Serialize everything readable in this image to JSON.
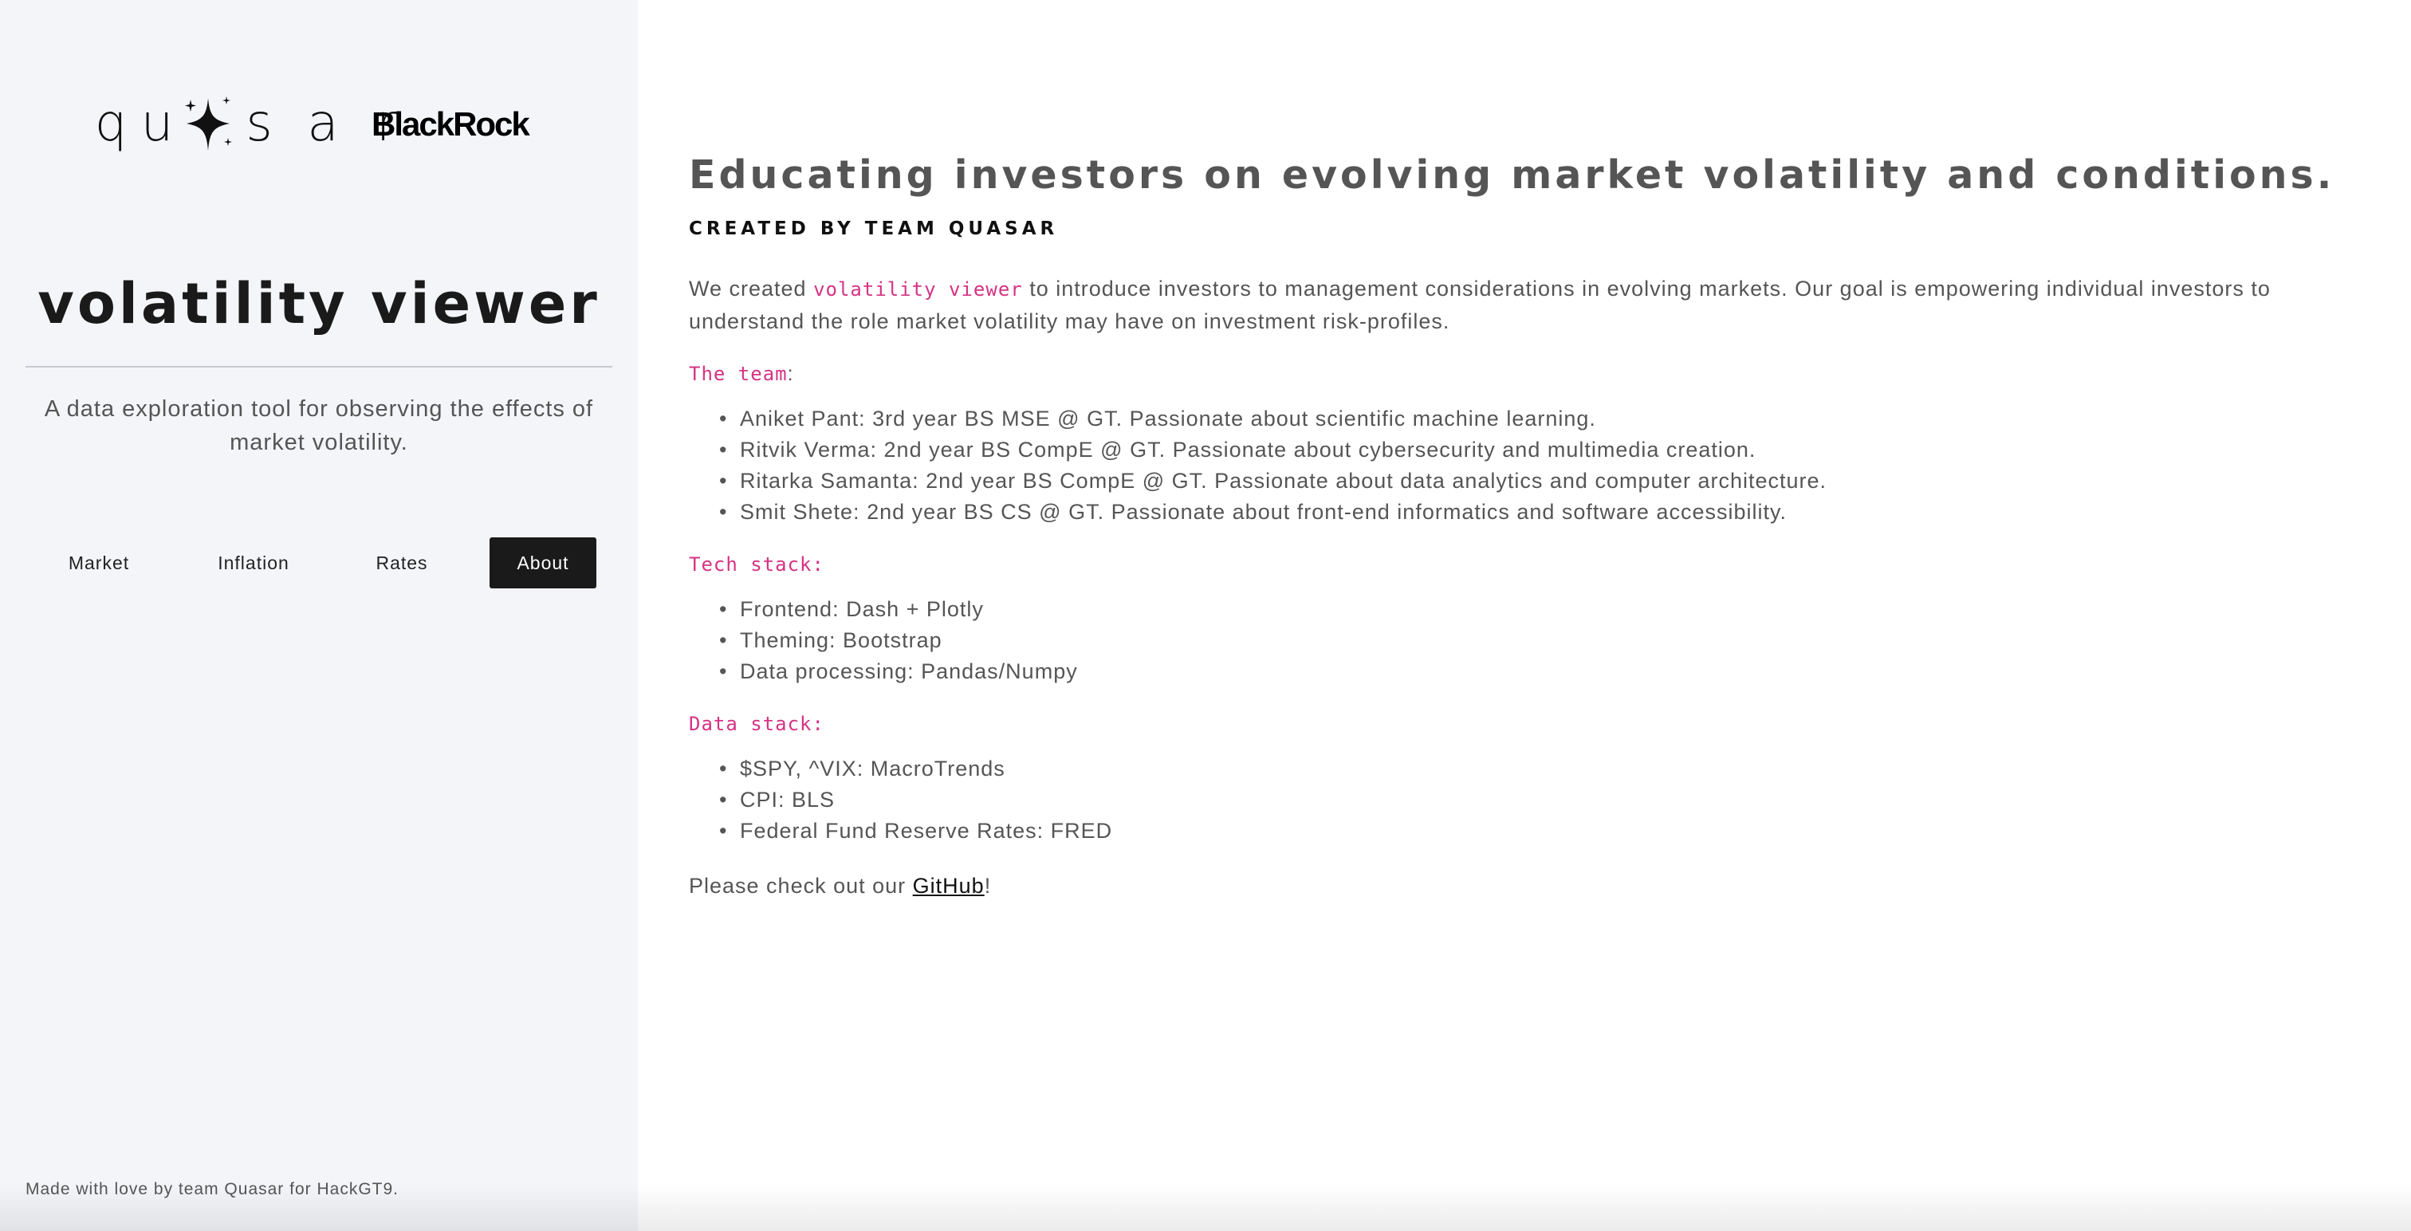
{
  "sidebar": {
    "logos": {
      "quasar_wordmark": "quasar",
      "blackrock_wordmark": "BlackRock"
    },
    "title": "volatility viewer",
    "subtitle": "A data exploration tool for observing the effects of market volatility.",
    "nav": [
      {
        "label": "Market",
        "active": false
      },
      {
        "label": "Inflation",
        "active": false
      },
      {
        "label": "Rates",
        "active": false
      },
      {
        "label": "About",
        "active": true
      }
    ],
    "footer": "Made with love by team Quasar for HackGT9."
  },
  "main": {
    "headline": "Educating investors on evolving market volatility and conditions.",
    "created_by": "CREATED BY TEAM QUASAR",
    "intro": {
      "before": "We created ",
      "highlight": "volatility viewer",
      "after": " to introduce investors to management considerations in evolving markets. Our goal is empowering individual investors to understand the role market volatility may have on investment risk-profiles."
    },
    "team": {
      "label": "The team",
      "suffix": ":",
      "members": [
        "Aniket Pant: 3rd year BS MSE @ GT. Passionate about scientific machine learning.",
        "Ritvik Verma: 2nd year BS CompE @ GT. Passionate about cybersecurity and multimedia creation.",
        "Ritarka Samanta: 2nd year BS CompE @ GT. Passionate about data analytics and computer architecture.",
        "Smit Shete: 2nd year BS CS @ GT. Passionate about front-end informatics and software accessibility."
      ]
    },
    "tech_stack": {
      "label": "Tech stack:",
      "items": [
        "Frontend: Dash + Plotly",
        "Theming: Bootstrap",
        "Data processing: Pandas/Numpy"
      ]
    },
    "data_stack": {
      "label": "Data stack:",
      "items": [
        "$SPY, ^VIX: MacroTrends",
        "CPI: BLS",
        "Federal Fund Reserve Rates: FRED"
      ]
    },
    "github": {
      "before": "Please check out our ",
      "link": "GitHub",
      "after": "!"
    }
  },
  "colors": {
    "sidebar_bg": "#f4f5f9",
    "accent": "#d63384",
    "active_nav_bg": "#1a1a1a"
  }
}
